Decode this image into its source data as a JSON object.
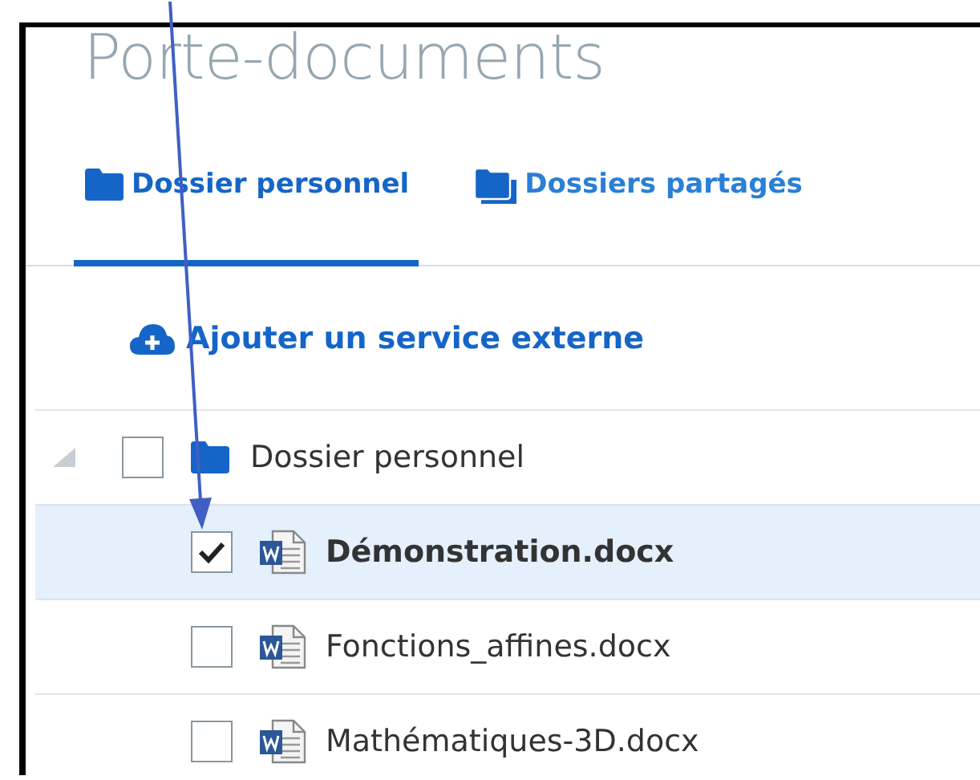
{
  "header": {
    "title": "Porte-documents"
  },
  "tabs": [
    {
      "label": "Dossier personnel",
      "selected": true
    },
    {
      "label": "Dossiers partagés",
      "selected": false
    }
  ],
  "add_service": {
    "label": "Ajouter un service externe"
  },
  "tree": [
    {
      "name": "Dossier personnel",
      "kind": "folder",
      "expanded": true,
      "checked": false,
      "selected": false,
      "children": [
        {
          "name": "Démonstration.docx",
          "kind": "document",
          "checked": true,
          "selected": true
        },
        {
          "name": "Fonctions_affines.docx",
          "kind": "document",
          "checked": false,
          "selected": false
        },
        {
          "name": "Mathématiques-3D.docx",
          "kind": "document",
          "checked": false,
          "selected": false
        }
      ]
    }
  ],
  "annotation": {
    "kind": "arrow"
  }
}
